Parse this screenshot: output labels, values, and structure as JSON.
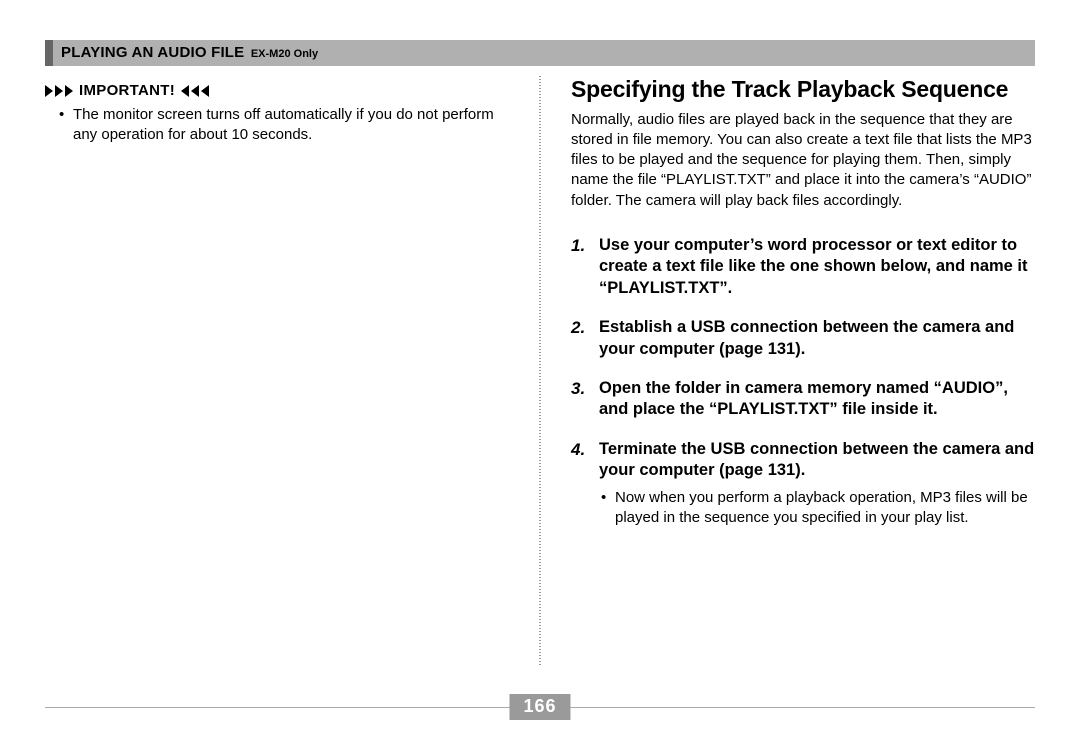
{
  "header": {
    "main": "PLAYING AN AUDIO FILE",
    "sub": "EX-M20 Only"
  },
  "left": {
    "important_label": "IMPORTANT!",
    "bullet": "The monitor screen turns off automatically if you do not perform any operation for about 10 seconds."
  },
  "right": {
    "heading": "Specifying the Track Playback Sequence",
    "intro": "Normally, audio files are played back in the sequence that they are stored in file memory. You can also create a text file that lists the MP3 files to be played and the sequence for playing them. Then, simply name the file “PLAYLIST.TXT” and place it into the camera’s “AUDIO” folder. The camera will play back files accordingly.",
    "steps": [
      {
        "n": "1.",
        "t": "Use your computer’s word processor or text editor to create a text file like the one shown below, and name it “PLAYLIST.TXT”."
      },
      {
        "n": "2.",
        "t": "Establish a USB connection between the camera and your computer (page 131)."
      },
      {
        "n": "3.",
        "t": "Open the folder in camera memory named “AUDIO”, and place the “PLAYLIST.TXT” file inside it."
      },
      {
        "n": "4.",
        "t": "Terminate the USB connection between the camera and your computer (page 131)."
      }
    ],
    "sub_bullet": "Now when you perform a playback operation, MP3 files will be played in the sequence you specified in your play list."
  },
  "page_number": "166"
}
